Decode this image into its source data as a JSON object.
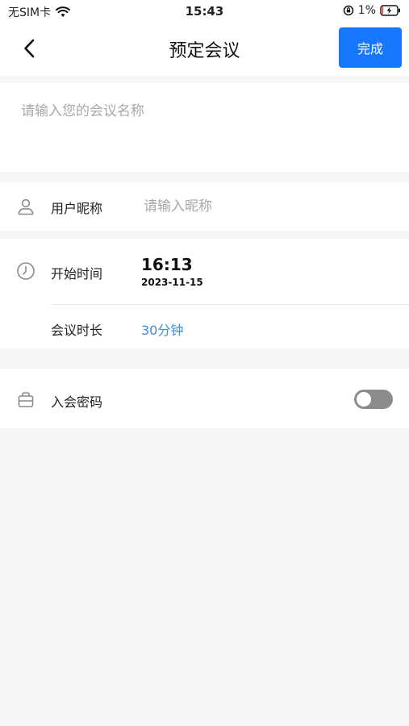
{
  "status_bar": {
    "carrier": "无SIM卡",
    "time": "15:43",
    "battery": "1%"
  },
  "nav": {
    "title": "预定会议",
    "done_label": "完成"
  },
  "meeting_name": {
    "placeholder": "请输入您的会议名称",
    "value": ""
  },
  "nickname": {
    "label": "用户昵称",
    "placeholder": "请输入昵称",
    "value": ""
  },
  "start_time": {
    "label": "开始时间",
    "time": "16:13",
    "date": "2023-11-15"
  },
  "duration": {
    "label": "会议时长",
    "value": "30分钟"
  },
  "password": {
    "label": "入会密码",
    "enabled": false
  },
  "colors": {
    "accent": "#1677ff",
    "link_blue": "#3a8fdb",
    "toggle_off": "#8c8c8c"
  }
}
